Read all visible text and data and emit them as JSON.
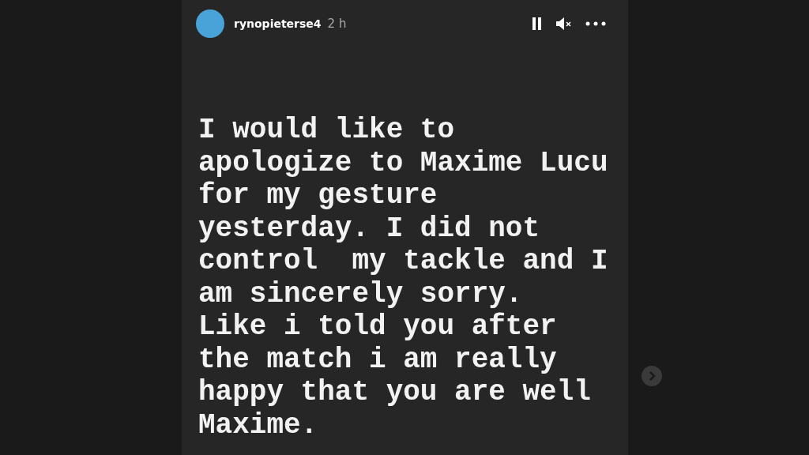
{
  "story": {
    "username": "rynopieterse4",
    "time": "2 h",
    "paused": false,
    "muted": true,
    "text_lines": [
      "I would like to",
      "apologize to Maxime Lucu",
      "for my gesture",
      "yesterday. I did not",
      "control  my tackle and I",
      "am sincerely sorry.",
      "Like i told you after",
      "the match i am really",
      "happy that you are well",
      "Maxime."
    ]
  }
}
